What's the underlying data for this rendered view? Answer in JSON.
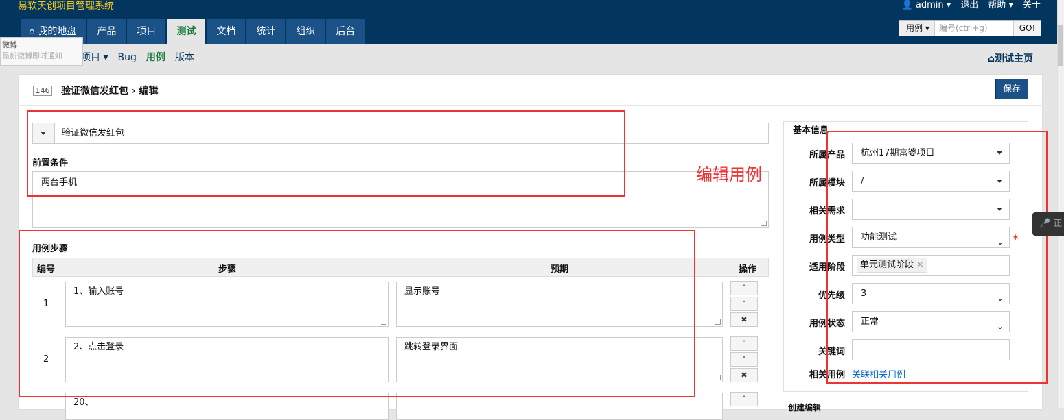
{
  "app": {
    "title": "易软天创项目管理系统"
  },
  "topbar": {
    "user": "admin",
    "logout": "退出",
    "help": "帮助",
    "about": "关于"
  },
  "nav": {
    "tabs": [
      "我的地盘",
      "产品",
      "项目",
      "测试",
      "文档",
      "统计",
      "组织",
      "后台"
    ],
    "active": "测试"
  },
  "search": {
    "type": "用例",
    "placeholder": "编号(ctrl+g)",
    "go": "GO!"
  },
  "tooltip": {
    "title": "微博",
    "subtitle": "最新微博即时通知"
  },
  "subnav": {
    "project": "项目",
    "bug": "Bug",
    "case": "用例",
    "version": "版本",
    "test_home": "测试主页"
  },
  "case": {
    "id": "146",
    "title": "验证微信发红包",
    "action": "编辑",
    "save": "保存"
  },
  "form": {
    "title_value": "验证微信发红包",
    "precondition_label": "前置条件",
    "precondition_value": "两台手机",
    "steps_label": "用例步骤",
    "col_no": "编号",
    "col_step": "步骤",
    "col_expect": "预期",
    "col_op": "操作",
    "steps": [
      {
        "no": "1",
        "step": "1、输入账号",
        "expect": "显示账号"
      },
      {
        "no": "2",
        "step": "2、点击登录",
        "expect": "跳转登录界面"
      },
      {
        "no": "",
        "step": "20、",
        "expect": ""
      }
    ]
  },
  "annotation": "编辑用例",
  "basic": {
    "legend": "基本信息",
    "product_label": "所属产品",
    "product": "杭州17期富婆项目",
    "module_label": "所属模块",
    "module": "/",
    "story_label": "相关需求",
    "story": "",
    "type_label": "用例类型",
    "type": "功能测试",
    "stage_label": "适用阶段",
    "stage": "单元测试阶段",
    "pri_label": "优先级",
    "pri": "3",
    "status_label": "用例状态",
    "status": "正常",
    "keywords_label": "关键词",
    "keywords": "",
    "linkcase_label": "相关用例",
    "linkcase": "关联相关用例",
    "required_mark": "*"
  },
  "footer": {
    "legend": "创建编辑"
  },
  "voice": {
    "label": "正"
  },
  "colors": {
    "topbar": "#03365e",
    "tab": "#1a5187",
    "logo": "#f5c518",
    "active": "#1b7a3e",
    "annotation": "#e33333"
  }
}
